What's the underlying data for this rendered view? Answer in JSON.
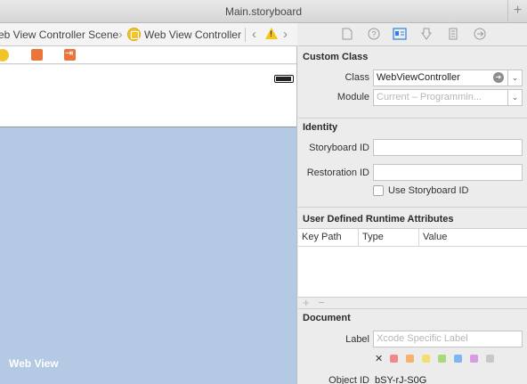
{
  "window": {
    "title": "Main.storyboard"
  },
  "jumpbar": {
    "scene_crumb": "eb View Controller Scene",
    "controller_crumb": "Web View Controller"
  },
  "canvas": {
    "webview_label": "Web View"
  },
  "inspector": {
    "tabs": [
      "file-icon",
      "help-icon",
      "identity-icon",
      "attributes-icon",
      "size-icon",
      "connections-icon"
    ],
    "custom_class": {
      "title": "Custom Class",
      "class_label": "Class",
      "class_value": "WebViewController",
      "module_label": "Module",
      "module_placeholder": "Current – Programmin..."
    },
    "identity": {
      "title": "Identity",
      "storyboard_id_label": "Storyboard ID",
      "storyboard_id_value": "",
      "restoration_id_label": "Restoration ID",
      "restoration_id_value": "",
      "use_storyboard_id_label": "Use Storyboard ID"
    },
    "runtime_attributes": {
      "title": "User Defined Runtime Attributes",
      "columns": [
        "Key Path",
        "Type",
        "Value"
      ],
      "add_label": "+",
      "remove_label": "−"
    },
    "document": {
      "title": "Document",
      "label_label": "Label",
      "label_placeholder": "Xcode Specific Label",
      "clear_label": "✕",
      "swatch_colors": [
        "#f08a8a",
        "#f5b26b",
        "#f3de6e",
        "#a6db7c",
        "#7bb7f0",
        "#d79be6",
        "#c8c8c8"
      ],
      "object_id_label": "Object ID",
      "object_id_value": "bSY-rJ-S0G"
    }
  }
}
